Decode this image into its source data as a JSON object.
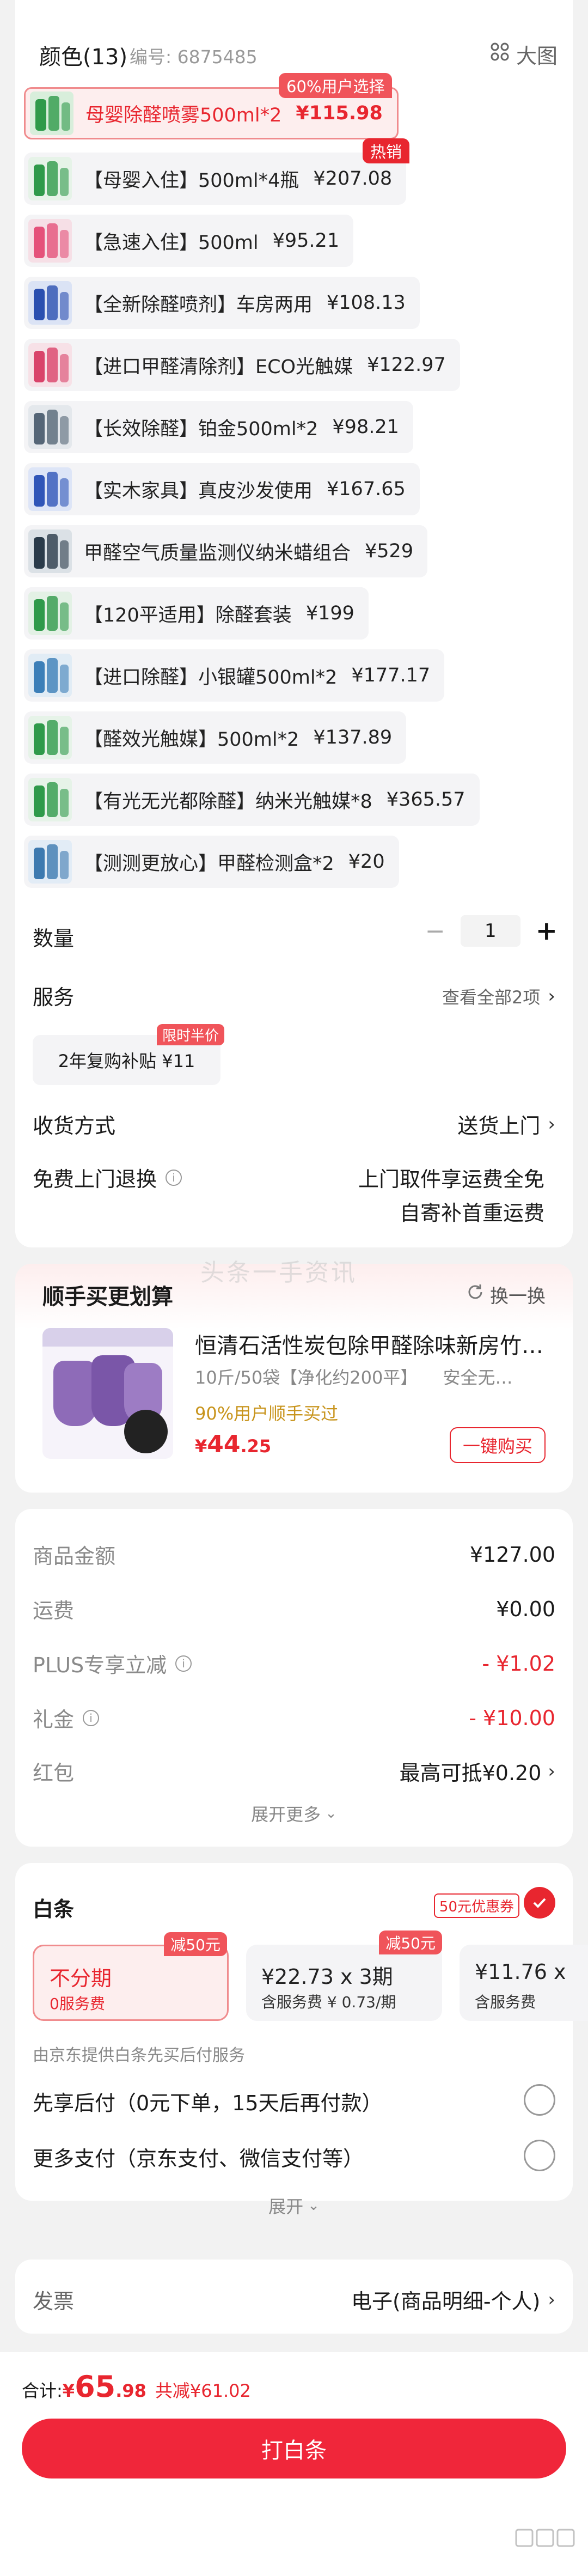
{
  "header": {
    "title": "颜色(13)",
    "code": "编号: 6875485",
    "big_view": "大图"
  },
  "variants": [
    {
      "label": "母婴除醛喷雾500ml*2",
      "price": "¥115.98",
      "selected": true,
      "tag": "60%用户选择"
    },
    {
      "label": "【母婴入住】500ml*4瓶",
      "price": "¥207.08",
      "tag": "热销"
    },
    {
      "label": "【急速入住】500ml",
      "price": "¥95.21"
    },
    {
      "label": "【全新除醛喷剂】车房两用",
      "price": "¥108.13"
    },
    {
      "label": "【进口甲醛清除剂】ECO光触媒",
      "price": "¥122.97"
    },
    {
      "label": "【长效除醛】铂金500ml*2",
      "price": "¥98.21"
    },
    {
      "label": "【实木家具】真皮沙发使用",
      "price": "¥167.65"
    },
    {
      "label": "甲醛空气质量监测仪纳米蜡组合",
      "price": "¥529"
    },
    {
      "label": "【120平适用】除醛套装",
      "price": "¥199"
    },
    {
      "label": "【进口除醛】小银罐500ml*2",
      "price": "¥177.17"
    },
    {
      "label": "【醛效光触媒】500ml*2",
      "price": "¥137.89"
    },
    {
      "label": "【有光无光都除醛】纳米光触媒*8",
      "price": "¥365.57"
    },
    {
      "label": "【测测更放心】甲醛检测盒*2",
      "price": "¥20"
    }
  ],
  "quantity": {
    "label": "数量",
    "value": "1",
    "minus": "−",
    "plus": "+"
  },
  "service": {
    "label": "服务",
    "view_all": "查看全部2项",
    "option": "2年复购补贴 ¥11",
    "option_tag": "限时半价"
  },
  "delivery": {
    "label": "收货方式",
    "value": "送货上门"
  },
  "return": {
    "label": "免费上门退换",
    "line1": "上门取件享运费全免",
    "line2": "自寄补首重运费"
  },
  "watermark": "头条一手资讯",
  "recommend": {
    "title": "顺手买更划算",
    "refresh": "换一换",
    "product": "恒清石活性炭包除甲醛除味新房竹…",
    "specs": "10斤/50袋【净化约200平】",
    "specs2": "安全无…",
    "stat": "90%用户顺手买过",
    "price_symbol": "¥",
    "price_int": "44",
    "price_dec": ".25",
    "buy": "一键购买"
  },
  "summary": {
    "goods_label": "商品金额",
    "goods_value": "¥127.00",
    "ship_label": "运费",
    "ship_value": "¥0.00",
    "plus_label": "PLUS专享立减",
    "plus_value": "- ¥1.02",
    "gift_label": "礼金",
    "gift_value": "- ¥10.00",
    "hongbao_label": "红包",
    "hongbao_value": "最高可抵¥0.20",
    "more": "展开更多"
  },
  "baitiao": {
    "label": "白条",
    "coupon": "50元优惠券",
    "plans": [
      {
        "title": "不分期",
        "sub": "0服务费",
        "tag": "减50元",
        "selected": true
      },
      {
        "title": "¥22.73 x 3期",
        "sub": "含服务费 ¥ 0.73/期",
        "tag": "减50元"
      },
      {
        "title": "¥11.76 x",
        "sub": "含服务费"
      }
    ],
    "note": "由京东提供白条先买后付服务",
    "opt1": "先享后付（0元下单，15天后再付款）",
    "opt2": "更多支付（京东支付、微信支付等）",
    "expand": "展开"
  },
  "invoice": {
    "label": "发票",
    "value": "电子(商品明细-个人)"
  },
  "footer": {
    "total_label": "合计: ",
    "symbol": "¥",
    "total_int": "65",
    "total_dec": ".98",
    "discount": "共减¥61.02",
    "pay": "打白条"
  },
  "colors": {
    "accent": "#e8262f",
    "button": "#f0263a"
  }
}
